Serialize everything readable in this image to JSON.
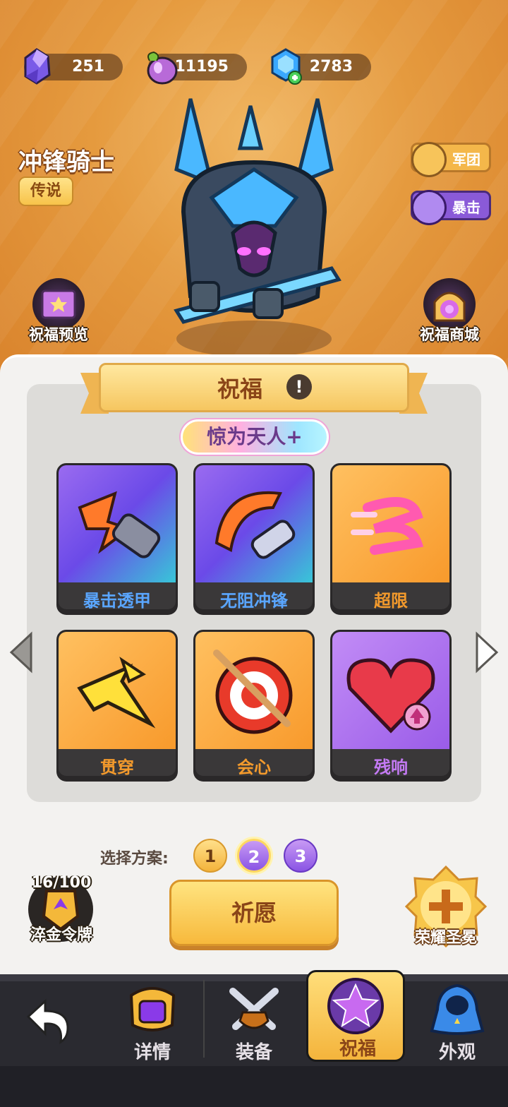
{
  "resources": [
    {
      "icon": "crystal-icon",
      "value": "251"
    },
    {
      "icon": "potion-icon",
      "value": "11195"
    },
    {
      "icon": "gem-plus-icon",
      "value": "2783"
    }
  ],
  "hero": {
    "name": "冲锋骑士",
    "rarity": "传说"
  },
  "tags": [
    {
      "label": "军团"
    },
    {
      "label": "暴击"
    }
  ],
  "corner": {
    "preview": "祝福预览",
    "shop": "祝福商城"
  },
  "panel": {
    "title": "祝福",
    "info": "!",
    "quality": "惊为天人+"
  },
  "blessings": [
    {
      "name": "暴击透甲",
      "color": "#5aa6ff"
    },
    {
      "name": "无阻冲锋",
      "color": "#5aa6ff"
    },
    {
      "name": "超限",
      "color": "#f39a2c"
    },
    {
      "name": "贯穿",
      "color": "#f39a2c"
    },
    {
      "name": "会心",
      "color": "#f39a2c"
    },
    {
      "name": "残响",
      "color": "#c47af4"
    }
  ],
  "plan": {
    "label": "选择方案:",
    "options": [
      "1",
      "2",
      "3"
    ],
    "selected": "2"
  },
  "wish_button": "祈愿",
  "medal": {
    "count": "16/100",
    "label": "淬金令牌"
  },
  "crown": {
    "label": "荣耀圣冕"
  },
  "nav": {
    "items": [
      {
        "label": ""
      },
      {
        "label": "详情"
      },
      {
        "label": "装备"
      },
      {
        "label": "祝福"
      },
      {
        "label": "外观"
      }
    ],
    "active": "祝福"
  }
}
